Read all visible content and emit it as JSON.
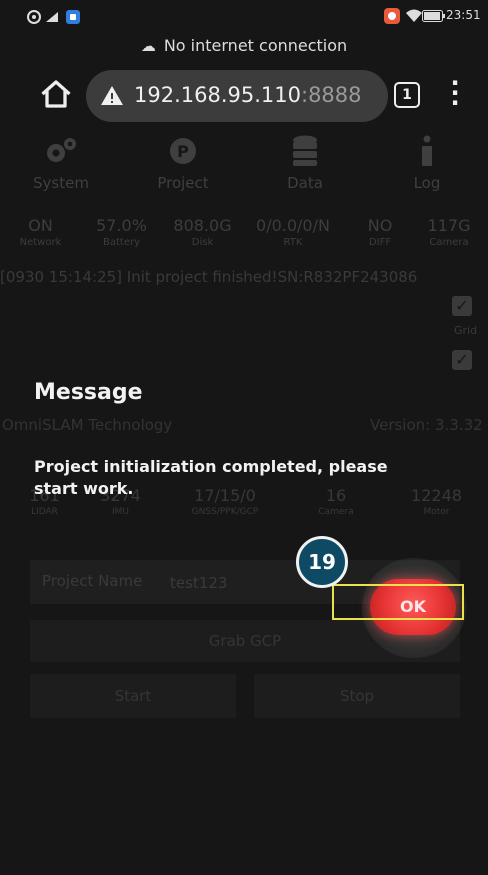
{
  "status_bar": {
    "time": "23:51"
  },
  "connection_banner": {
    "text": "No internet connection"
  },
  "browser": {
    "url_host": "192.168.95.110",
    "url_port": ":8888",
    "tab_count": "1"
  },
  "nav": {
    "items": [
      {
        "label": "System",
        "icon": "gears-icon"
      },
      {
        "label": "Project",
        "icon": "p-circle-icon"
      },
      {
        "label": "Data",
        "icon": "database-icon"
      },
      {
        "label": "Log",
        "icon": "info-icon"
      }
    ]
  },
  "stats": [
    {
      "value": "ON",
      "label": "Network"
    },
    {
      "value": "57.0%",
      "label": "Battery"
    },
    {
      "value": "808.0G",
      "label": "Disk"
    },
    {
      "value": "0/0.0/0/N",
      "label": "RTK"
    },
    {
      "value": "NO",
      "label": "DIFF"
    },
    {
      "value": "117G",
      "label": "Camera"
    }
  ],
  "log_line": "[0930 15:14:25] Init project finished!SN:R832PF243086",
  "grid_label": "Grid",
  "tech": {
    "name": "OmniSLAM Technology",
    "version": "Version: 3.3.32"
  },
  "stats2": [
    {
      "value": "161",
      "label": "LIDAR"
    },
    {
      "value": "3274",
      "label": "IMU"
    },
    {
      "value": "17/15/0",
      "label": "GNSS/PPK/GCP"
    },
    {
      "value": "16",
      "label": "Camera"
    },
    {
      "value": "12248",
      "label": "Motor"
    }
  ],
  "project": {
    "label": "Project Name",
    "value": "test123"
  },
  "buttons": {
    "grab": "Grab GCP",
    "start": "Start",
    "stop": "Stop"
  },
  "dialog": {
    "title": "Message",
    "body": "Project initialization completed, please start work.",
    "ok": "OK"
  },
  "annotation": {
    "step": "19"
  }
}
